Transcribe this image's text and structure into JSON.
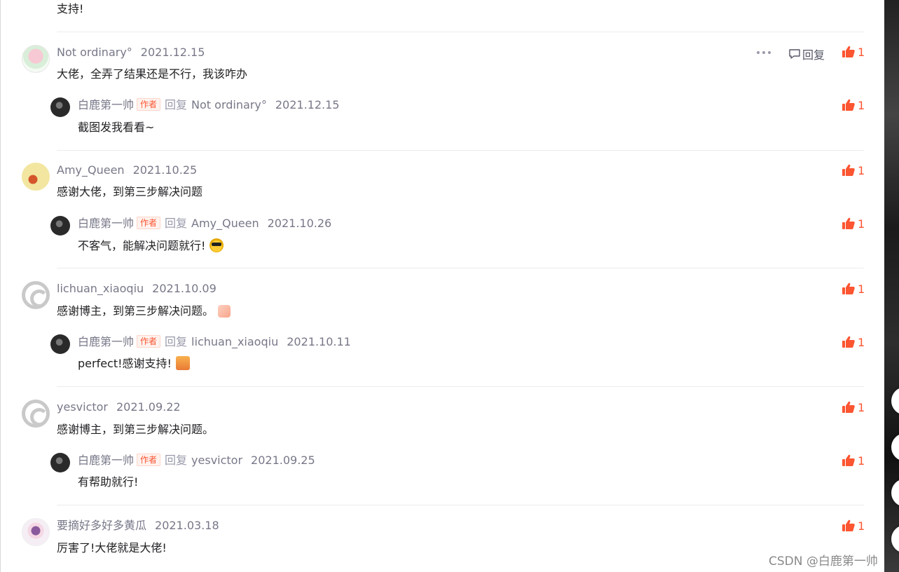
{
  "top_text": "支持!",
  "reply_label": "回复",
  "author_tag": "作者",
  "reply_word": "回复",
  "comments": [
    {
      "user": "Not ordinary°",
      "date": "2021.12.15",
      "text": "大佬，全弄了结果还是不行，我该咋办",
      "likes": "1",
      "reply": {
        "user": "白鹿第一帅",
        "target": "Not ordinary°",
        "date": "2021.12.15",
        "text": "截图发我看看~",
        "likes": "1"
      }
    },
    {
      "user": "Amy_Queen",
      "date": "2021.10.25",
      "text": "感谢大佬，到第三步解决问题",
      "likes": "1",
      "reply": {
        "user": "白鹿第一帅",
        "target": "Amy_Queen",
        "date": "2021.10.26",
        "text": "不客气，能解决问题就行!",
        "likes": "1"
      }
    },
    {
      "user": "lichuan_xiaoqiu",
      "date": "2021.10.09",
      "text": "感谢博主，到第三步解决问题。",
      "likes": "1",
      "reply": {
        "user": "白鹿第一帅",
        "target": "lichuan_xiaoqiu",
        "date": "2021.10.11",
        "text": "perfect!感谢支持!",
        "likes": "1"
      }
    },
    {
      "user": "yesvictor",
      "date": "2021.09.22",
      "text": "感谢博主，到第三步解决问题。",
      "likes": "1",
      "reply": {
        "user": "白鹿第一帅",
        "target": "yesvictor",
        "date": "2021.09.25",
        "text": "有帮助就行!",
        "likes": "1"
      }
    },
    {
      "user": "要摘好多好多黄瓜",
      "date": "2021.03.18",
      "text": "厉害了!大佬就是大佬!",
      "likes": "1"
    }
  ],
  "watermark": "CSDN @白鹿第一帅",
  "colors": {
    "accent": "#fc5531",
    "meta": "#777888",
    "divider": "#ececec"
  },
  "icons": {
    "like": "thumbs-up-icon",
    "reply": "comment-bubble-icon",
    "more": "more-dots-icon"
  }
}
